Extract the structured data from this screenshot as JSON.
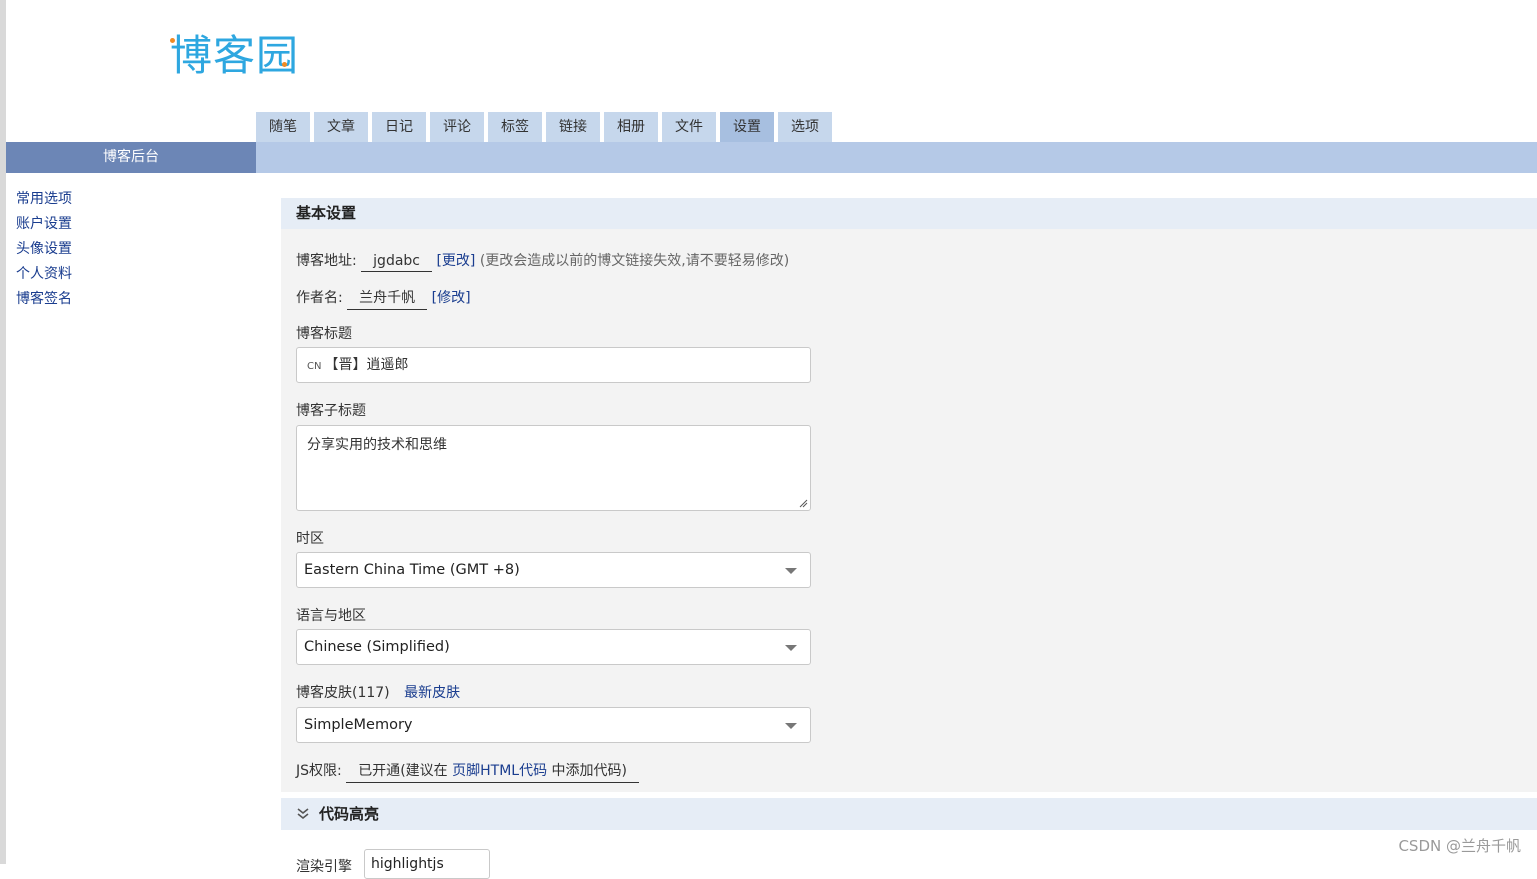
{
  "logo": {
    "text": "博客园"
  },
  "tabs": [
    {
      "label": "随笔"
    },
    {
      "label": "文章"
    },
    {
      "label": "日记"
    },
    {
      "label": "评论"
    },
    {
      "label": "标签"
    },
    {
      "label": "链接"
    },
    {
      "label": "相册"
    },
    {
      "label": "文件"
    },
    {
      "label": "设置"
    },
    {
      "label": "选项"
    }
  ],
  "sidebar": {
    "title": "博客后台",
    "items": [
      {
        "label": "常用选项"
      },
      {
        "label": "账户设置"
      },
      {
        "label": "头像设置"
      },
      {
        "label": "个人资料"
      },
      {
        "label": "博客签名"
      }
    ]
  },
  "basic": {
    "title": "基本设置",
    "blog_address_label": "博客地址:",
    "blog_address_value": "jgdabc",
    "blog_address_change": "[更改]",
    "blog_address_hint": "(更改会造成以前的博文链接失效,请不要轻易修改)",
    "author_label": "作者名:",
    "author_value": "兰舟千帆",
    "author_change": "[修改]",
    "blog_title_label": "博客标题",
    "blog_title_prefix": "CN",
    "blog_title_value": "【晋】逍遥郎",
    "subtitle_label": "博客子标题",
    "subtitle_value": "分享实用的技术和思维",
    "timezone_label": "时区",
    "timezone_value": "Eastern China Time (GMT +8)",
    "language_label": "语言与地区",
    "language_value": "Chinese (Simplified)",
    "skin_label": "博客皮肤(117)",
    "skin_link": "最新皮肤",
    "skin_value": "SimpleMemory",
    "js_label": "JS权限:",
    "js_status": "已开通",
    "js_hint_prefix": "(建议在",
    "js_hint_link": "页脚HTML代码",
    "js_hint_suffix": "中添加代码)"
  },
  "code_highlight": {
    "title": "代码高亮",
    "engine_label": "渲染引擎",
    "engine_value": "highlightjs"
  },
  "watermark": "CSDN @兰舟千帆"
}
